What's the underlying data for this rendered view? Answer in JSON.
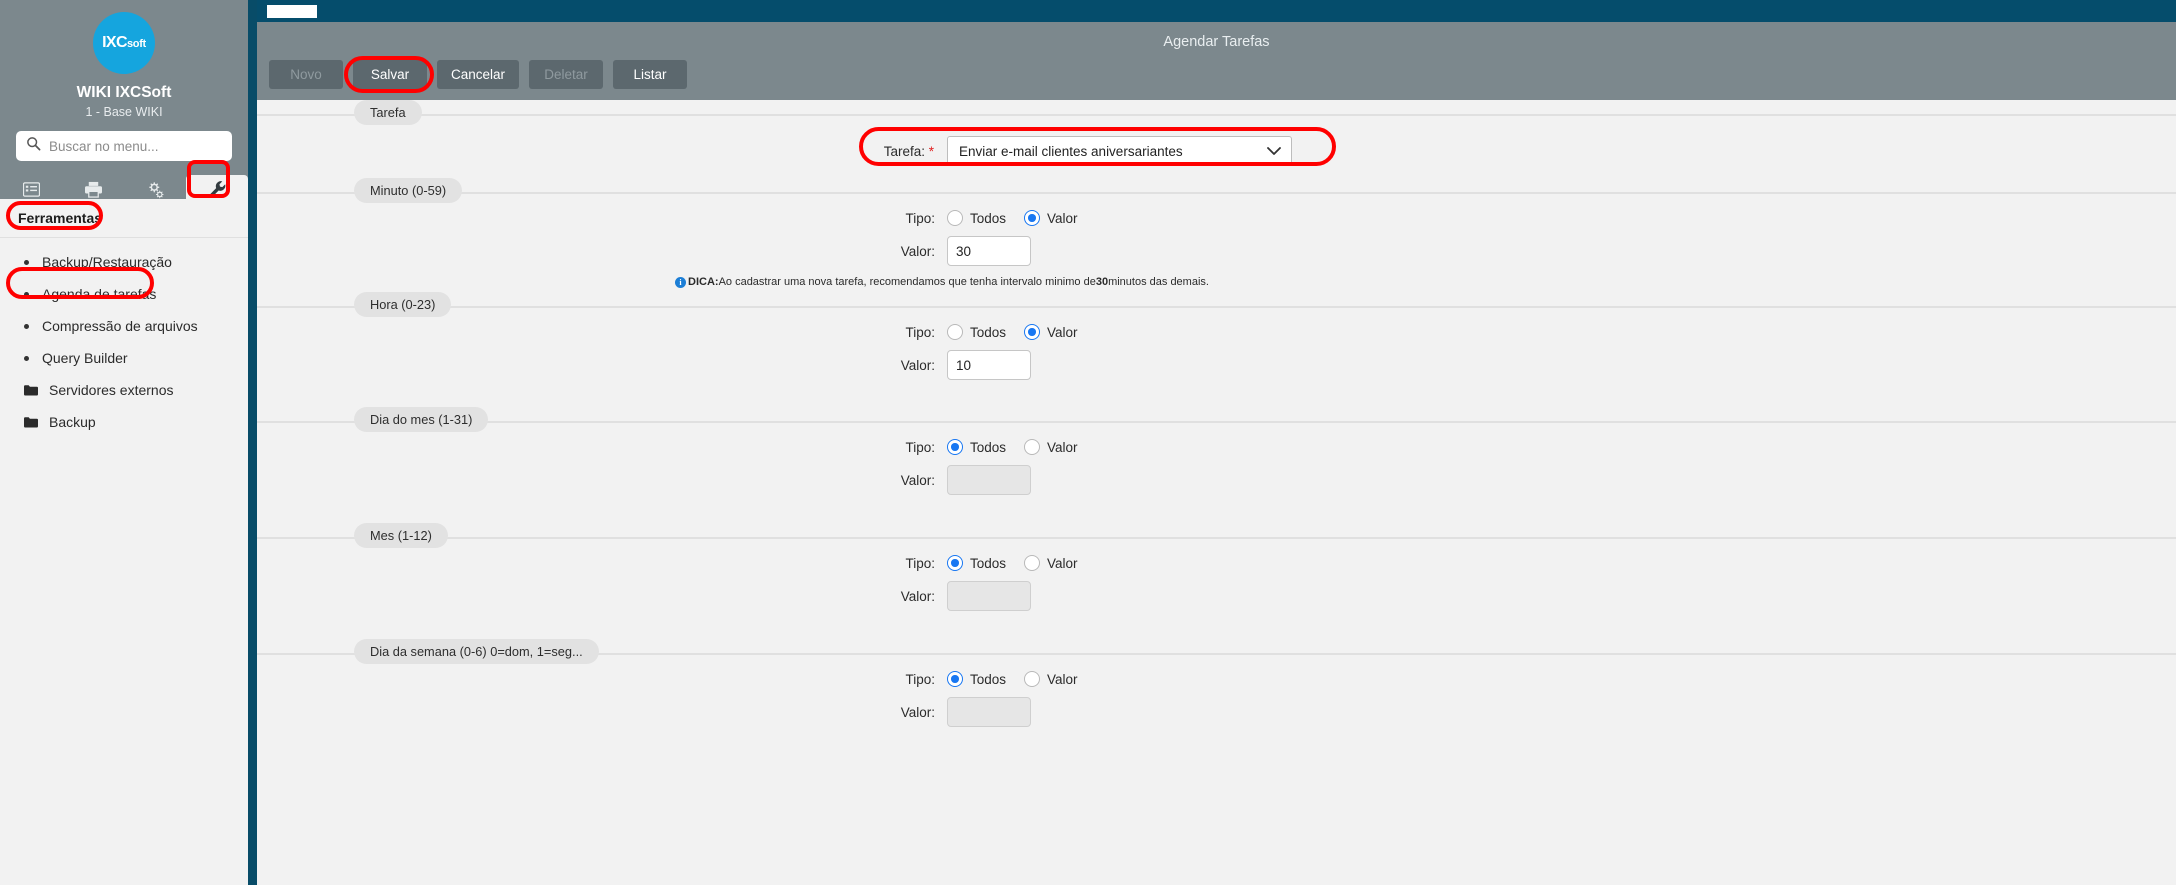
{
  "sidebar": {
    "logo_text": "IXC",
    "logo_suffix": "soft",
    "brand_title": "WIKI IXCSoft",
    "brand_subtitle": "1 - Base WIKI",
    "search_placeholder": "Buscar no menu...",
    "search_value": "",
    "icon_tabs": [
      {
        "name": "list-icon",
        "label": "Listagens"
      },
      {
        "name": "printer-icon",
        "label": "Relatórios"
      },
      {
        "name": "gears-icon",
        "label": "Configurações"
      },
      {
        "name": "wrench-icon",
        "label": "Ferramentas"
      }
    ],
    "active_icon_tab_index": 3,
    "section_title": "Ferramentas",
    "items": [
      {
        "label": "Backup/Restauração",
        "type": "link",
        "active": false
      },
      {
        "label": "Agenda de tarefas",
        "type": "link",
        "active": true
      },
      {
        "label": "Compressão de arquivos",
        "type": "link",
        "active": false
      },
      {
        "label": "Query Builder",
        "type": "link",
        "active": false
      },
      {
        "label": "Servidores externos",
        "type": "folder",
        "active": false
      },
      {
        "label": "Backup",
        "type": "folder",
        "active": false
      }
    ]
  },
  "header": {
    "title": "Agendar Tarefas"
  },
  "toolbar": {
    "buttons": [
      {
        "label": "Novo",
        "name": "novo-button",
        "disabled": true
      },
      {
        "label": "Salvar",
        "name": "salvar-button",
        "disabled": false
      },
      {
        "label": "Cancelar",
        "name": "cancelar-button",
        "disabled": false
      },
      {
        "label": "Deletar",
        "name": "deletar-button",
        "disabled": true
      },
      {
        "label": "Listar",
        "name": "listar-button",
        "disabled": false
      }
    ]
  },
  "form": {
    "tarefa_group_legend": "Tarefa",
    "tarefa_label": "Tarefa:",
    "tarefa_required_mark": "*",
    "tarefa_selected": "Enviar e-mail clientes aniversariantes",
    "tipo_label": "Tipo:",
    "valor_label": "Valor:",
    "radio_todos": "Todos",
    "radio_valor": "Valor",
    "tip_prefix": "DICA:",
    "tip_part1": "Ao cadastrar uma nova tarefa, recomendamos que tenha intervalo minimo de ",
    "tip_bold": "30",
    "tip_part2": " minutos das demais.",
    "sections": [
      {
        "legend": "Minuto (0-59)",
        "tipo_selected": "valor",
        "valor": "30",
        "valor_disabled": false,
        "has_tip": true
      },
      {
        "legend": "Hora (0-23)",
        "tipo_selected": "valor",
        "valor": "10",
        "valor_disabled": false,
        "has_tip": false
      },
      {
        "legend": "Dia do mes (1-31)",
        "tipo_selected": "todos",
        "valor": "",
        "valor_disabled": true,
        "has_tip": false
      },
      {
        "legend": "Mes (1-12)",
        "tipo_selected": "todos",
        "valor": "",
        "valor_disabled": true,
        "has_tip": false
      },
      {
        "legend": "Dia da semana (0-6) 0=dom, 1=seg...",
        "tipo_selected": "todos",
        "valor": "",
        "valor_disabled": true,
        "has_tip": false
      }
    ]
  },
  "colors": {
    "accent_dark": "#084c68",
    "topbar": "#054d6c",
    "toolbar_gray": "#7c888d",
    "button_gray": "#5c686e",
    "radio_blue": "#1877f2",
    "highlight_red": "#ff0000",
    "logo_blue": "#15a5de",
    "page_bg": "#f2f2f2"
  },
  "annotations": {
    "highlights": [
      "wrench-icon",
      "ferramentas-section-title",
      "agenda-de-tarefas-item",
      "salvar-button",
      "tarefa-select-field"
    ]
  }
}
